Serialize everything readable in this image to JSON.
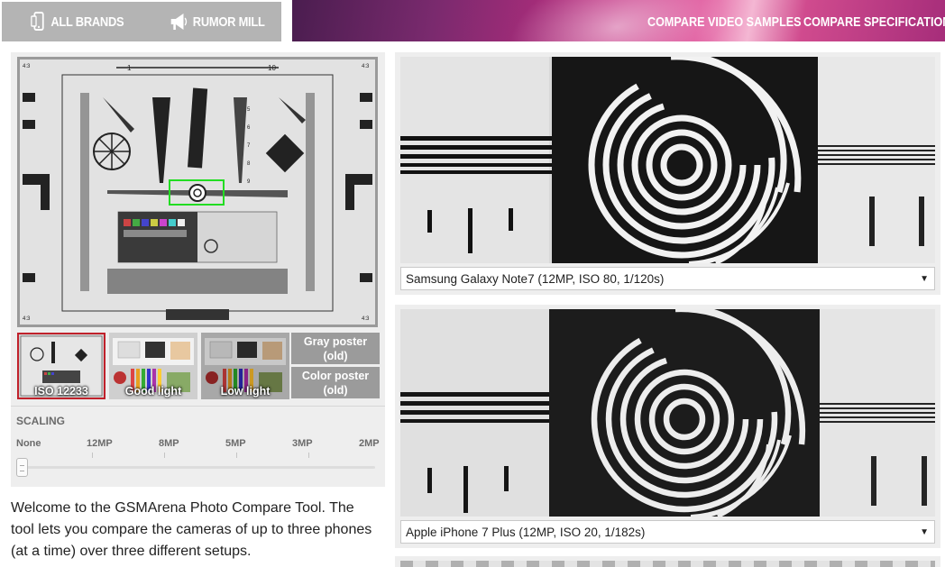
{
  "header": {
    "nav": [
      {
        "label": "ALL BRANDS",
        "icon": "phone-icon"
      },
      {
        "label": "RUMOR MILL",
        "icon": "megaphone-icon"
      }
    ],
    "banner_links": [
      "COMPARE VIDEO SAMPLES",
      "COMPARE SPECIFICATIONS"
    ]
  },
  "setups": {
    "thumbs": [
      {
        "label": "ISO 12233",
        "active": true
      },
      {
        "label": "Good light",
        "active": false
      },
      {
        "label": "Low light",
        "active": false
      }
    ],
    "posters": [
      {
        "line1": "Gray poster",
        "line2": "(old)"
      },
      {
        "line1": "Color poster",
        "line2": "(old)"
      }
    ]
  },
  "scaling": {
    "title": "SCALING",
    "options": [
      "None",
      "12MP",
      "8MP",
      "5MP",
      "3MP",
      "2MP"
    ],
    "selected_index": 0
  },
  "intro": "Welcome to the GSMArena Photo Compare Tool. The tool lets you compare the cameras of up to three phones (at a time) over three different setups.",
  "comparisons": [
    {
      "phone": "Samsung Galaxy Note7 (12MP, ISO 80, 1/120s)"
    },
    {
      "phone": "Apple iPhone 7 Plus (12MP, ISO 20, 1/182s)"
    }
  ],
  "chart_labels": {
    "top_numbers": [
      "1",
      "10"
    ],
    "side_numbers": [
      "2",
      "3",
      "4",
      "5",
      "6",
      "7",
      "8",
      "9"
    ],
    "corner_ratio": "4:3"
  },
  "colors": {
    "nav_bg": "#b4b4b4",
    "panel_bg": "#eeeeee",
    "active_outline": "#c0212b",
    "poster_bg": "#9b9b9b",
    "focus_box": "#22dd22"
  }
}
